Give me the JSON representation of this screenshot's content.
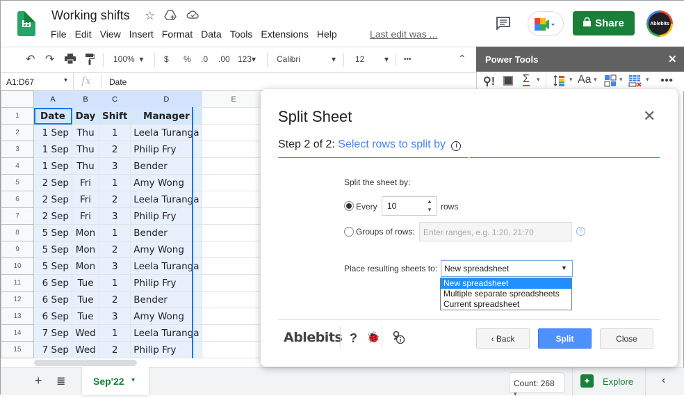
{
  "app": {
    "doc_title": "Working shifts",
    "menu": [
      "File",
      "Edit",
      "View",
      "Insert",
      "Format",
      "Data",
      "Tools",
      "Extensions",
      "Help"
    ],
    "last_edit": "Last edit was ...",
    "share_label": "Share",
    "avatar_label": "Ablebits"
  },
  "toolbar": {
    "zoom": "100%",
    "currency": "$",
    "percent": "%",
    "dec_decrease": ".0",
    "dec_increase": ".00",
    "number_format": "123",
    "font": "Calibri",
    "font_size": "12",
    "more": "•••"
  },
  "formula_bar": {
    "name_box": "A1:D67",
    "fx": "fx",
    "content": "Date"
  },
  "power_tools": {
    "title": "Power Tools",
    "close": "✕"
  },
  "sheet": {
    "columns": [
      "A",
      "B",
      "C",
      "D",
      "E"
    ],
    "header": [
      "Date",
      "Day",
      "Shift",
      "Manager"
    ],
    "rows": [
      [
        "1 Sep",
        "Thu",
        "1",
        "Leela Turanga"
      ],
      [
        "1 Sep",
        "Thu",
        "2",
        "Philip Fry"
      ],
      [
        "1 Sep",
        "Thu",
        "3",
        "Bender"
      ],
      [
        "2 Sep",
        "Fri",
        "1",
        "Amy Wong"
      ],
      [
        "2 Sep",
        "Fri",
        "2",
        "Leela Turanga"
      ],
      [
        "2 Sep",
        "Fri",
        "3",
        "Philip Fry"
      ],
      [
        "5 Sep",
        "Mon",
        "1",
        "Bender"
      ],
      [
        "5 Sep",
        "Mon",
        "2",
        "Amy Wong"
      ],
      [
        "5 Sep",
        "Mon",
        "3",
        "Leela Turanga"
      ],
      [
        "6 Sep",
        "Tue",
        "1",
        "Philip Fry"
      ],
      [
        "6 Sep",
        "Tue",
        "2",
        "Bender"
      ],
      [
        "6 Sep",
        "Tue",
        "3",
        "Amy Wong"
      ],
      [
        "7 Sep",
        "Wed",
        "1",
        "Leela Turanga"
      ],
      [
        "7 Sep",
        "Wed",
        "2",
        "Philip Fry"
      ]
    ]
  },
  "bottom": {
    "sheet_tab": "Sep'22",
    "count": "Count: 268",
    "explore": "Explore"
  },
  "dialog": {
    "title": "Split Sheet",
    "step_prefix": "Step 2 of 2:",
    "step_name": "Select rows to split by",
    "split_by_label": "Split the sheet by:",
    "every_label": "Every",
    "every_value": "10",
    "rows_label": "rows",
    "groups_label": "Groups of rows:",
    "groups_placeholder": "Enter ranges, e.g. 1:20, 21:70",
    "place_label": "Place resulting sheets to:",
    "place_selected": "New spreadsheet",
    "place_options": [
      "New spreadsheet",
      "Multiple separate spreadsheets",
      "Current spreadsheet"
    ],
    "brand": "Ablebits",
    "help": "?",
    "back_label": "Back",
    "split_label": "Split",
    "close_label": "Close"
  }
}
